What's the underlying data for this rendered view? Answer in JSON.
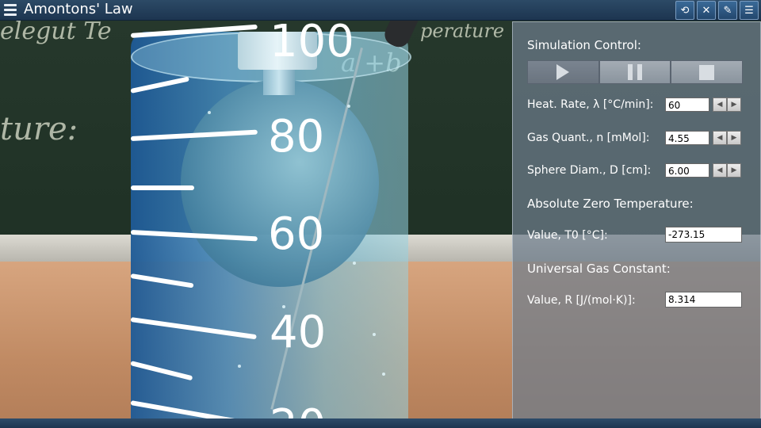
{
  "app": {
    "title": "Amontons' Law",
    "toolbar_icons": [
      "refresh-icon",
      "mute-icon",
      "pencil-icon",
      "list-icon"
    ]
  },
  "scene": {
    "scale_labels": [
      "100",
      "80",
      "60",
      "40",
      "20"
    ]
  },
  "panel": {
    "simulation_control": "Simulation Control:",
    "buttons": [
      "play",
      "pause",
      "stop"
    ],
    "heat_rate": {
      "label": "Heat. Rate, λ [°C/min]:",
      "value": "60"
    },
    "gas_quantity": {
      "label": "Gas Quant., n [mMol]:",
      "value": "4.55"
    },
    "sphere_diameter": {
      "label": "Sphere Diam., D [cm]:",
      "value": "6.00"
    },
    "absolute_zero_title": "Absolute Zero Temperature:",
    "t0": {
      "label": "Value, T0 [°C]:",
      "value": "-273.15"
    },
    "gas_constant_title": "Universal Gas Constant:",
    "r": {
      "label": "Value, R [J/(mol·K)]:",
      "value": "8.314"
    }
  },
  "colors": {
    "titlebar": "#1d3550",
    "panel": "#6e7d8c",
    "liquid": "#2e6fa8"
  }
}
